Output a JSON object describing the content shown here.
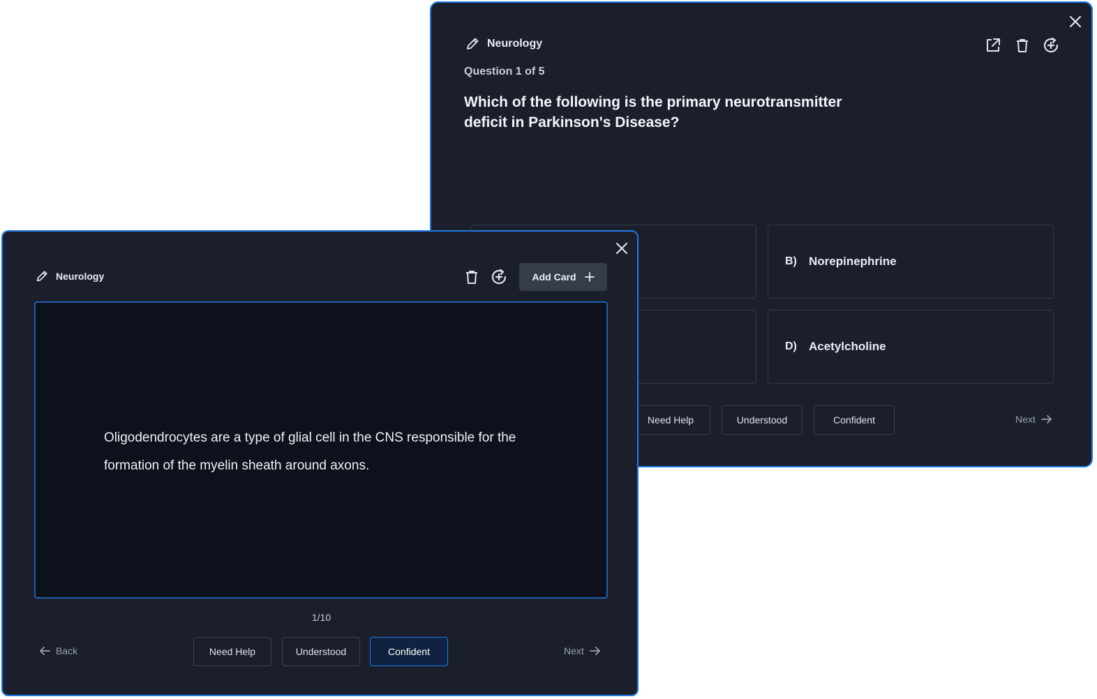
{
  "quiz": {
    "deck_name": "Neurology",
    "question_counter": "Question 1 of 5",
    "question": "Which of the following is the primary neurotransmitter deficit in Parkinson's Disease?",
    "options": [
      {
        "letter": "B)",
        "text": "Norepinephrine"
      },
      {
        "letter": "D)",
        "text": "Acetylcholine"
      }
    ],
    "ratings": [
      "Need Help",
      "Understood",
      "Confident"
    ],
    "next_label": "Next",
    "icons": [
      "pencil-icon",
      "share-icon",
      "trash-icon",
      "refresh-icon",
      "close-icon"
    ]
  },
  "flashcard": {
    "deck_name": "Neurology",
    "add_card_label": "Add Card",
    "card_text": "Oligodendrocytes are a type of glial cell in the CNS responsible for the formation of the myelin sheath around axons.",
    "counter": "1/10",
    "back_label": "Back",
    "next_label": "Next",
    "ratings": [
      "Need Help",
      "Understood",
      "Confident"
    ],
    "active_rating": "Confident",
    "colors": {
      "accent": "#1f7ae6",
      "panel": "#1a1f2b",
      "card": "#0d111b"
    }
  }
}
